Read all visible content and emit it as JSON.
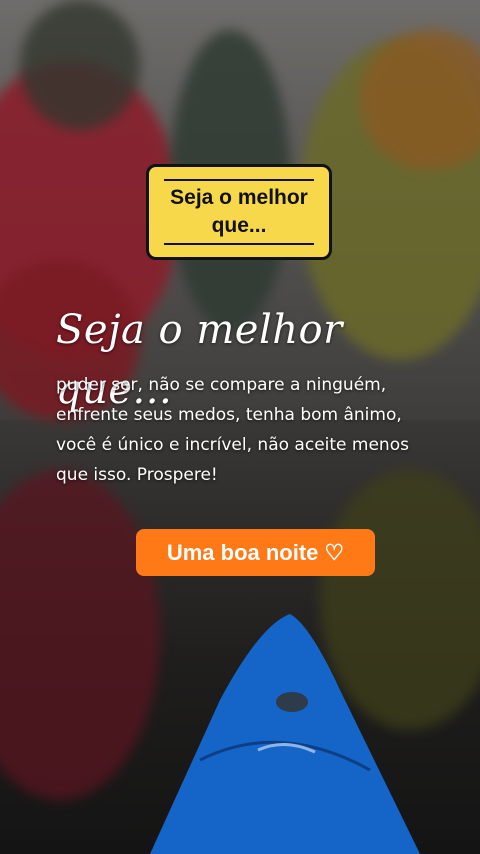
{
  "caption_box": {
    "text": "Seja o melhor que..."
  },
  "headline": "Seja o melhor que...",
  "message": "puder ser, não se compare a ninguém, enfrente seus medos, tenha bom ânimo, você é único e incrível, não aceite menos que isso. Prospere!",
  "greeting_button": {
    "label": "Uma boa noite",
    "icon": "heart-icon",
    "icon_glyph": "♡"
  },
  "colors": {
    "caption_bg": "#f6d84a",
    "button_bg": "#ff7a16",
    "text": "#ffffff"
  }
}
